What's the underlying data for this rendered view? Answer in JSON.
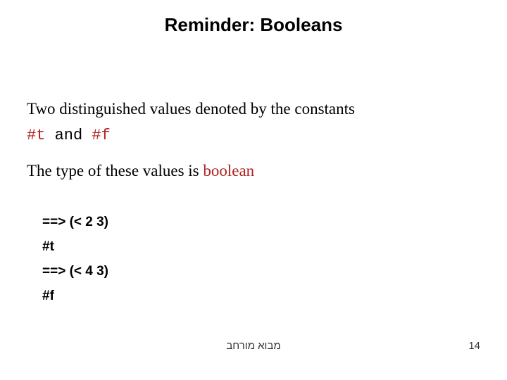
{
  "title": "Reminder: Booleans",
  "line1": "Two distinguished values denoted by the constants",
  "line2_t": "#t",
  "line2_and": " and ",
  "line2_f": "#f",
  "line3_pre": "The type of these values is ",
  "line3_bool": "boolean",
  "code": {
    "l1": "==> (< 2 3)",
    "l2": "#t",
    "l3": "==> (< 4 3)",
    "l4": "#f"
  },
  "footer": "מבוא מורחב",
  "page": "14"
}
